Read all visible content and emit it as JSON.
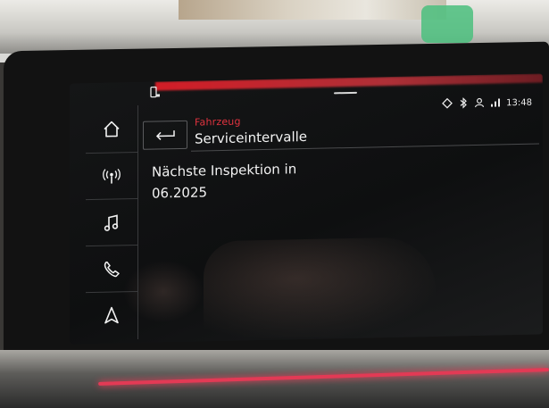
{
  "status_bar": {
    "clock": "13:48",
    "icons": [
      "phone-icon",
      "navigation-pin-icon",
      "bluetooth-icon",
      "user-icon",
      "signal-icon"
    ]
  },
  "nav": {
    "items": [
      {
        "name": "home",
        "icon": "home-icon"
      },
      {
        "name": "radio",
        "icon": "radio-icon"
      },
      {
        "name": "media",
        "icon": "music-note-icon"
      },
      {
        "name": "phone",
        "icon": "phone-icon"
      },
      {
        "name": "navigation",
        "icon": "navigation-arrow-icon"
      }
    ]
  },
  "header": {
    "breadcrumb": "Fahrzeug",
    "title": "Serviceintervalle",
    "back_icon": "back-arrow-icon"
  },
  "content": {
    "inspection_label": "Nächste Inspektion in",
    "inspection_value": "06.2025"
  },
  "colors": {
    "accent_red": "#e1333f",
    "screen_bg": "#121314",
    "text": "#f2f2f2"
  }
}
